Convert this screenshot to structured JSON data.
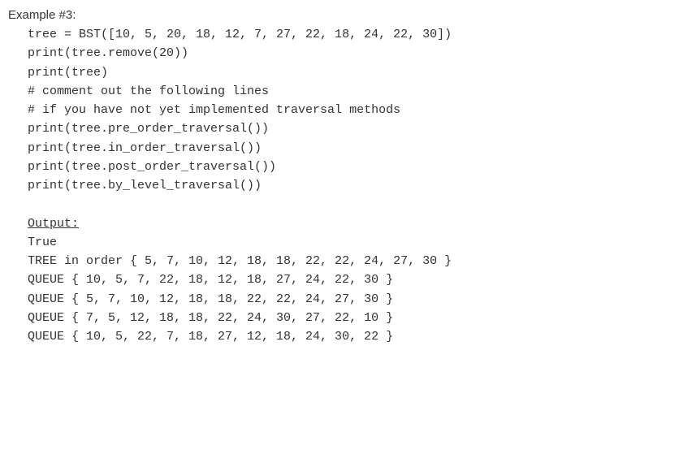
{
  "title": "Example #3:",
  "code": {
    "lines": [
      "tree = BST([10, 5, 20, 18, 12, 7, 27, 22, 18, 24, 22, 30])",
      "print(tree.remove(20))",
      "print(tree)",
      "# comment out the following lines",
      "# if you have not yet implemented traversal methods",
      "print(tree.pre_order_traversal())",
      "print(tree.in_order_traversal())",
      "print(tree.post_order_traversal())",
      "print(tree.by_level_traversal())"
    ]
  },
  "output": {
    "header": "Output:",
    "lines": [
      "True",
      "TREE in order { 5, 7, 10, 12, 18, 18, 22, 22, 24, 27, 30 }",
      "QUEUE { 10, 5, 7, 22, 18, 12, 18, 27, 24, 22, 30 }",
      "QUEUE { 5, 7, 10, 12, 18, 18, 22, 22, 24, 27, 30 }",
      "QUEUE { 7, 5, 12, 18, 18, 22, 24, 30, 27, 22, 10 }",
      "QUEUE { 10, 5, 22, 7, 18, 27, 12, 18, 24, 30, 22 }"
    ]
  }
}
